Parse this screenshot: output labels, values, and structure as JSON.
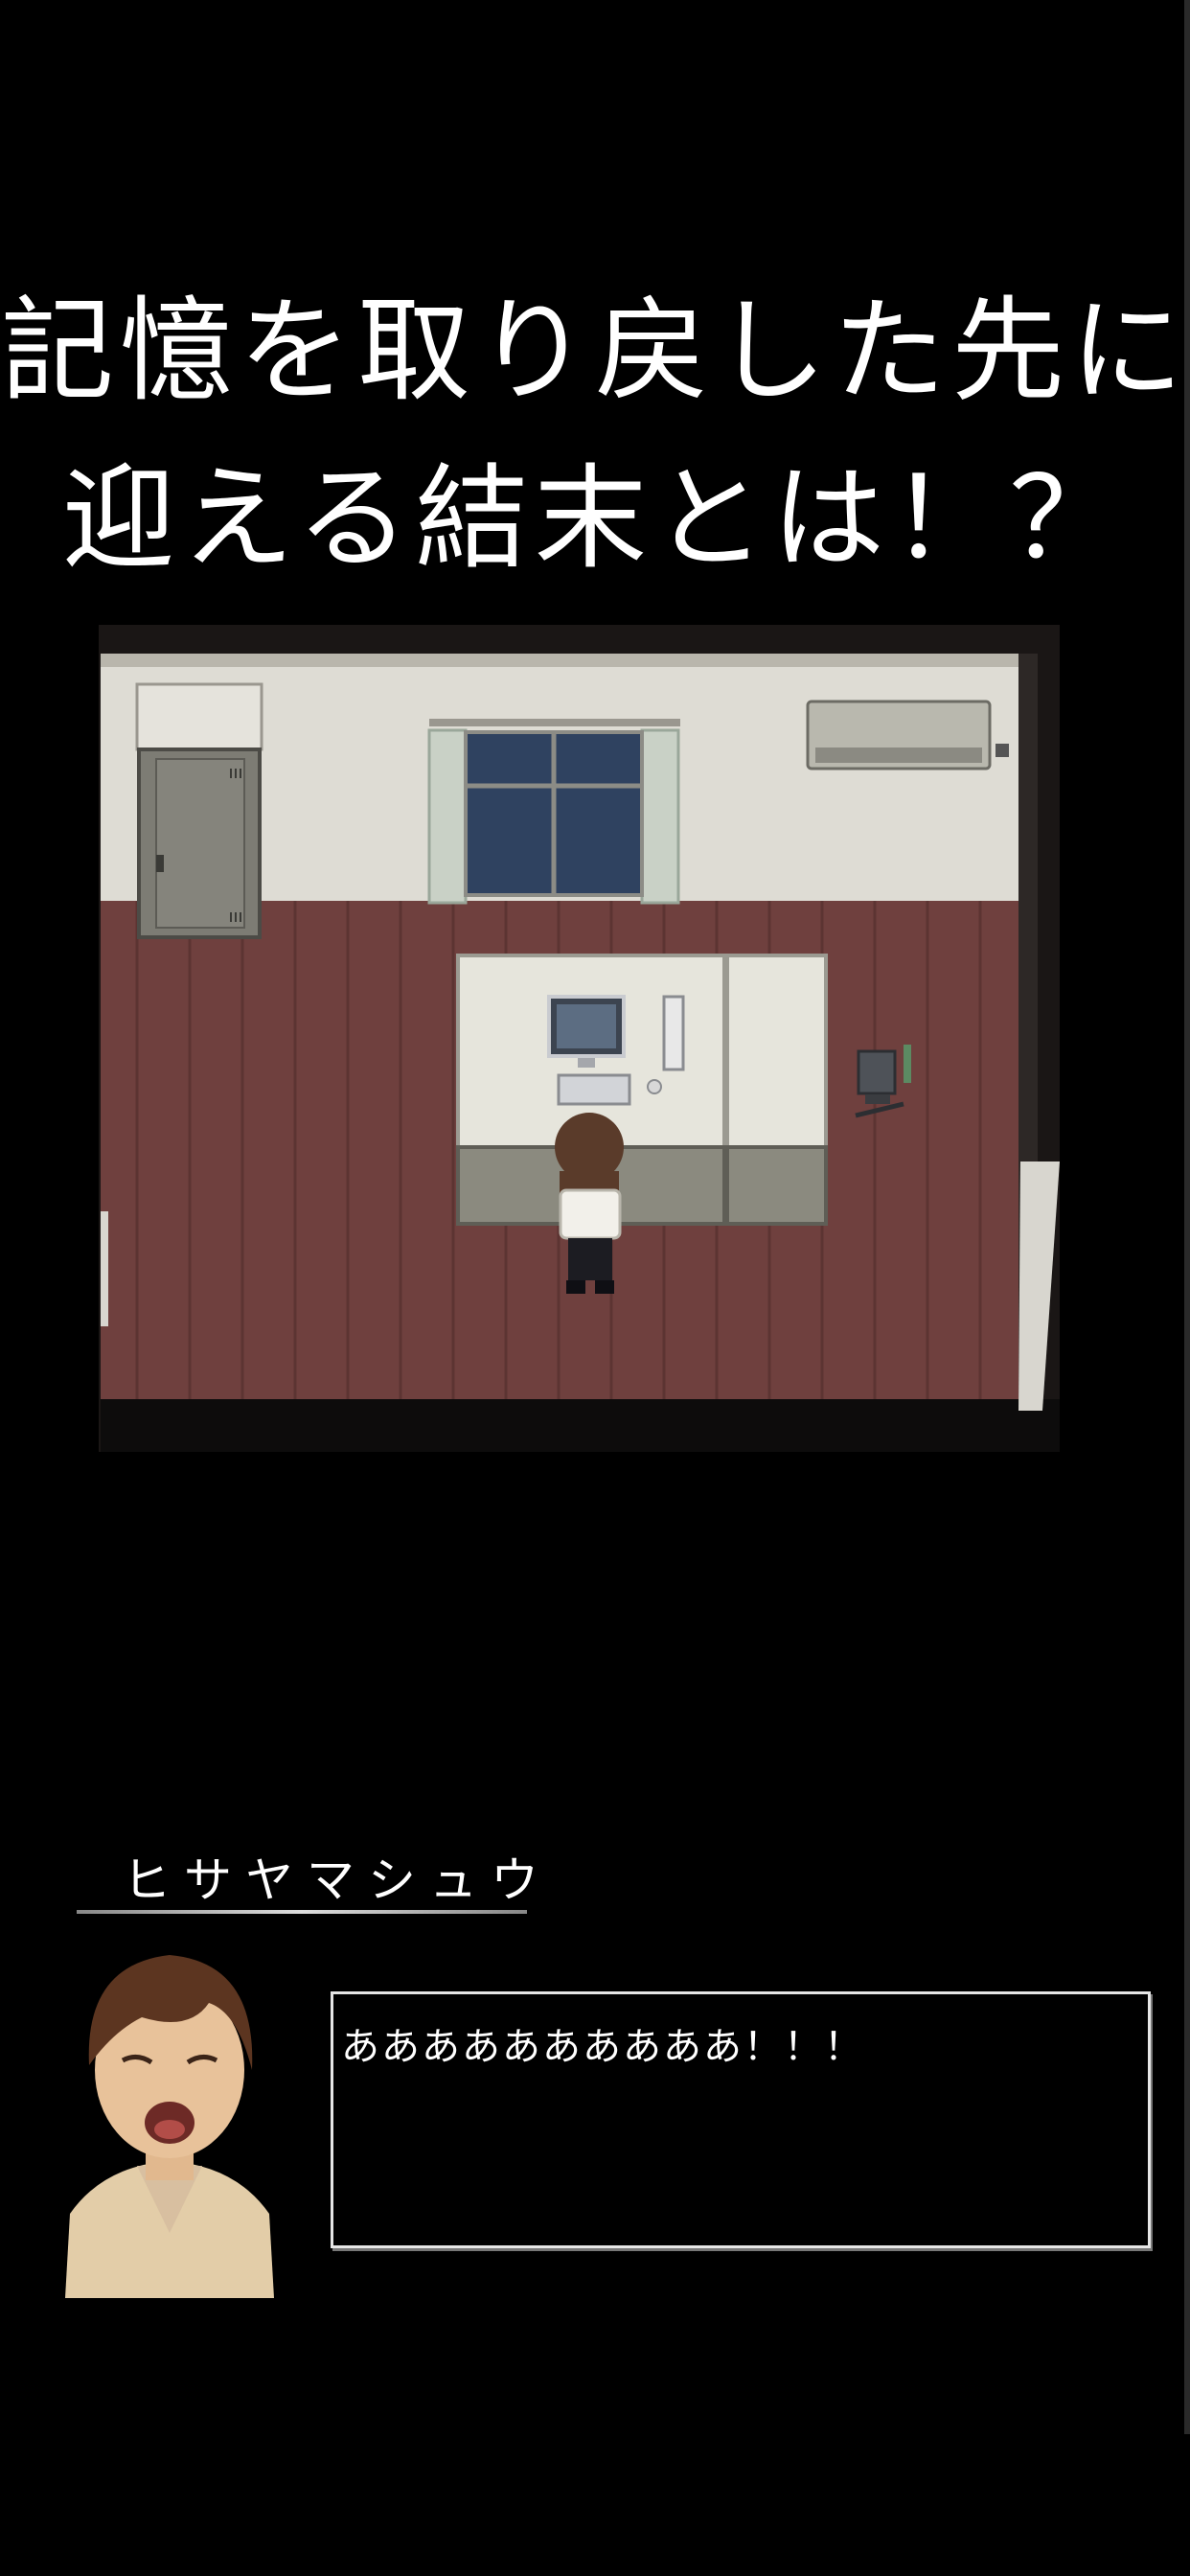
{
  "headline": {
    "line1": "記憶を取り戻した先に",
    "line2": "迎える結末とは！？"
  },
  "dialog": {
    "speaker_name": "ヒサヤマシュウ",
    "message": "ああああああああああ！！！"
  },
  "colors": {
    "background": "#000000",
    "floor": "#6e3f3d",
    "wall": "#dcdcd6",
    "text": "#ffffff"
  }
}
